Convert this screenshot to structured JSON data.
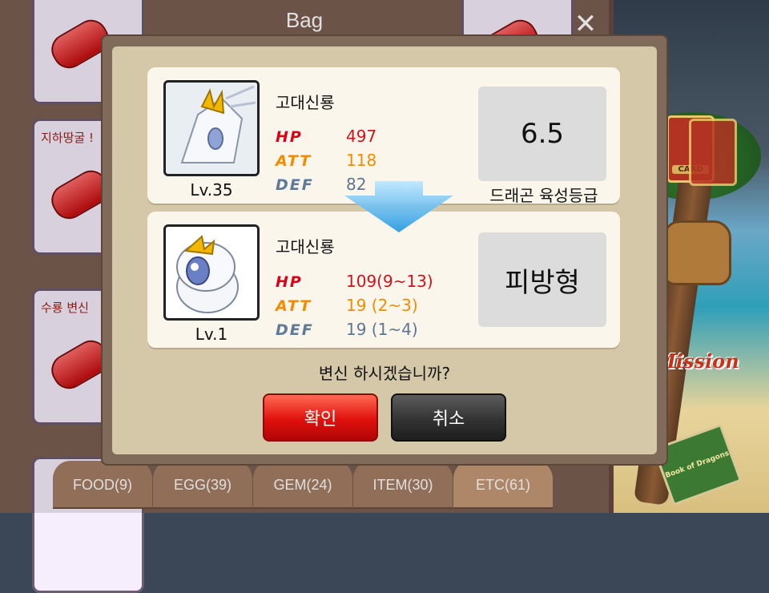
{
  "bag": {
    "title": "Bag",
    "close_label": "✕",
    "slots": [
      {
        "label": ""
      },
      {
        "label": "지하땅굴 !"
      },
      {
        "label": "수룡 변신"
      },
      {
        "label": ""
      },
      {
        "label": ""
      }
    ],
    "tabs": [
      {
        "label": "FOOD(9)"
      },
      {
        "label": "EGG(39)"
      },
      {
        "label": "GEM(24)"
      },
      {
        "label": "ITEM(30)"
      },
      {
        "label": "ETC(61)"
      }
    ]
  },
  "side_menu": {
    "card_label": "CARD",
    "mission_label": "Mission",
    "book_label": "Book of Dragons"
  },
  "dialog": {
    "current": {
      "name": "고대신룡",
      "level": "Lv.35",
      "stats": {
        "hp": {
          "key": "HP",
          "value": "497"
        },
        "att": {
          "key": "ATT",
          "value": "118"
        },
        "def": {
          "key": "DEF",
          "value": "82"
        }
      },
      "grade_value": "6.5",
      "grade_caption": "드래곤 육성등급"
    },
    "result": {
      "name": "고대신룡",
      "level": "Lv.1",
      "stats": {
        "hp": {
          "key": "HP",
          "value": "109(9~13)"
        },
        "att": {
          "key": "ATT",
          "value": "19  (2~3)"
        },
        "def": {
          "key": "DEF",
          "value": "19  (1~4)"
        }
      },
      "type_label": "피방형"
    },
    "question": "변신 하시겠습니까?",
    "confirm_label": "확인",
    "cancel_label": "취소"
  },
  "colors": {
    "hp": "#e00012",
    "att": "#f28c00",
    "def": "#5f7a98",
    "confirm": "#e0100c",
    "cancel": "#333333"
  },
  "icons": [
    "close-icon",
    "arrow-down-icon",
    "card-icon",
    "bag-icon",
    "mission-icon",
    "book-icon",
    "potion-icon"
  ]
}
